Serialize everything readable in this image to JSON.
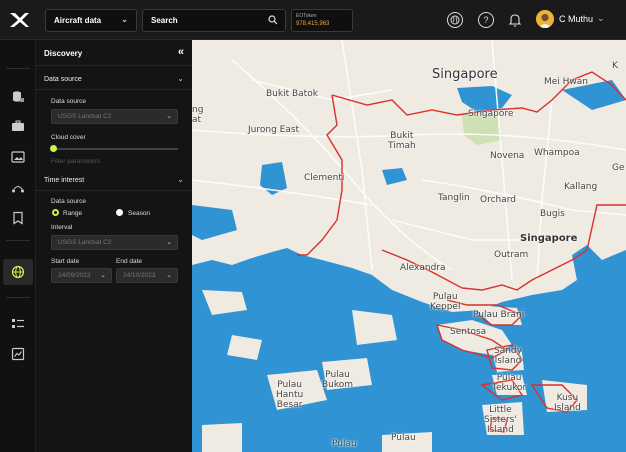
{
  "app": {
    "dataset_dropdown": "Aircraft data",
    "search_label": "Search",
    "token": {
      "label": "EOToken",
      "value": "978,415,963"
    },
    "user": {
      "name": "C Muthu"
    }
  },
  "panel": {
    "title": "Discovery",
    "collapse_glyph": "«",
    "data_source_section": {
      "title": "Data source",
      "data_source_label": "Data source",
      "data_source_value": "USGS Landsat C2",
      "cloud_cover_label": "Cloud cover",
      "cloud_cover_value": 0,
      "filter_params": "Filter parameters"
    },
    "time_interest_section": {
      "title": "Time interest",
      "data_source_label": "Data source",
      "range_label": "Range",
      "season_label": "Season",
      "selected_mode": "Range",
      "interval_label": "Interval",
      "interval_value": "USGS Landsat C2",
      "start_date_label": "Start date",
      "start_date_value": "24/09/2023",
      "end_date_label": "End date",
      "end_date_value": "24/10/2023"
    }
  },
  "map": {
    "places": [
      {
        "id": "singapore-top",
        "text": "Singapore"
      },
      {
        "id": "mei-hwan",
        "text": "Mei Hwan"
      },
      {
        "id": "k",
        "text": "K"
      },
      {
        "id": "bukit-batok",
        "text": "Bukit Batok"
      },
      {
        "id": "ng",
        "text": "ng"
      },
      {
        "id": "dt",
        "text": "at"
      },
      {
        "id": "jurong-east",
        "text": "Jurong East"
      },
      {
        "id": "singapore-small",
        "text": "Singapore"
      },
      {
        "id": "bukit-timah",
        "text": "Bukit\nTimah"
      },
      {
        "id": "novena",
        "text": "Novena"
      },
      {
        "id": "whampoa",
        "text": "Whampoa"
      },
      {
        "id": "ge",
        "text": "Ge"
      },
      {
        "id": "clementi",
        "text": "Clementi"
      },
      {
        "id": "kallang",
        "text": "Kallang"
      },
      {
        "id": "tanglin",
        "text": "Tanglin"
      },
      {
        "id": "orchard",
        "text": "Orchard"
      },
      {
        "id": "bugis",
        "text": "Bugis"
      },
      {
        "id": "singapore-center",
        "text": "Singapore"
      },
      {
        "id": "outram",
        "text": "Outram"
      },
      {
        "id": "alexandra",
        "text": "Alexandra"
      },
      {
        "id": "pulau-keppel",
        "text": "Pulau\nKeppel"
      },
      {
        "id": "pulau-brani",
        "text": "Pulau Brani"
      },
      {
        "id": "sentosa",
        "text": "Sentosa"
      },
      {
        "id": "sandy-island",
        "text": "Sandy\nIsland"
      },
      {
        "id": "pulau-tekukor",
        "text": "Pulau\nTekukor"
      },
      {
        "id": "kusu-island",
        "text": "Kusu\nIsland"
      },
      {
        "id": "little-sisters-island",
        "text": "Little\nSisters'\nIsland"
      },
      {
        "id": "pulau-bukom",
        "text": "Pulau\nBukom"
      },
      {
        "id": "pulau-hantu-besar",
        "text": "Pulau\nHantu\nBesar"
      },
      {
        "id": "pulau-bottom-1",
        "text": "Pulau"
      },
      {
        "id": "pulau-bottom-2",
        "text": "Pulau"
      }
    ]
  },
  "colors": {
    "accent": "#c8f34a",
    "token": "#f0a23a",
    "boundary": "#d6312b",
    "sea": "#2f93d4",
    "land": "#efeae2"
  }
}
